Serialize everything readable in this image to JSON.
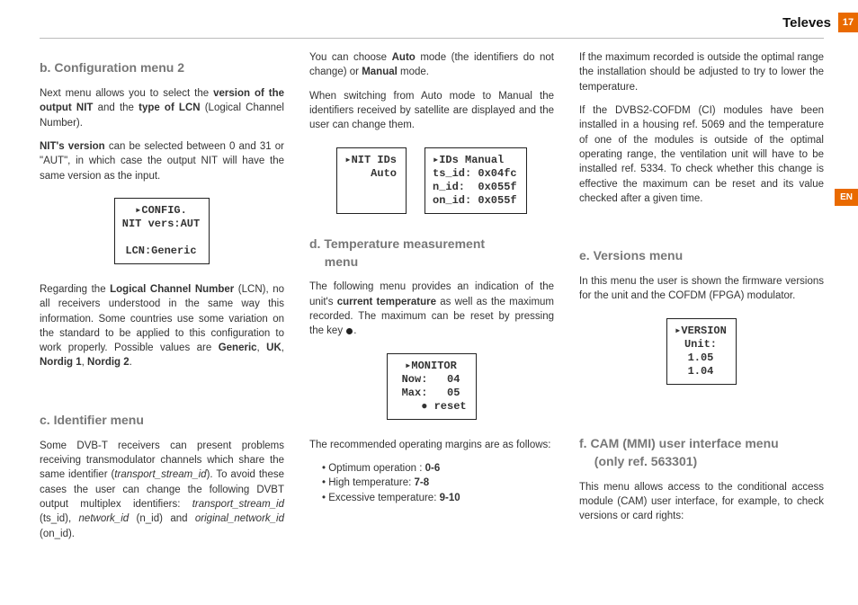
{
  "header": {
    "brand": "Televes",
    "pagenum": "17",
    "lang": "EN"
  },
  "col1": {
    "h_b": "b. Configuration menu 2",
    "p1a": "Next menu allows you to select the ",
    "p1b": "version of the output NIT",
    "p1c": " and the ",
    "p1d": "type of LCN",
    "p1e": " (Logical Channel Number).",
    "p2a": "NIT's version",
    "p2b": " can be selected between 0 and 31 or \"AUT\", in which case the output NIT will have the same version as the input.",
    "lcd1": "▸CONFIG.\nNIT vers:AUT\n\nLCN:Generic",
    "p3a": "Regarding the ",
    "p3b": "Logical Channel Number",
    "p3c": " (LCN), no all receivers understood in the same way this information. Some countries use some variation on the standard to be applied to this configuration to work properly. Possible values are ",
    "p3d": "Generic",
    "p3e": ", ",
    "p3f": "UK",
    "p3g": ", ",
    "p3h": "Nordig 1",
    "p3i": ", ",
    "p3j": "Nordig 2",
    "p3k": ".",
    "h_c": "c. Identifier menu",
    "p4a": "Some DVB-T receivers can present problems receiving transmodulator channels which share the same identifier (",
    "p4b": "transport_stream_id",
    "p4c": "). To avoid these cases the user can change the following DVBT output multiplex identifiers: ",
    "p4d": "transport_stream_id",
    "p4e": " (ts_id), ",
    "p4f": "network_id",
    "p4g": " (n_id) and ",
    "p4h": "original_network_id",
    "p4i": " (on_id)."
  },
  "col2": {
    "p1a": "You can choose ",
    "p1b": "Auto",
    "p1c": " mode (the identifiers do not change) or ",
    "p1d": "Manual",
    "p1e": " mode.",
    "p2": "When switching from Auto mode to Manual the identifiers received by satellite are displayed and the user can change them.",
    "lcdA": "▸NIT IDs\n    Auto",
    "lcdB": "▸IDs Manual\nts_id: 0x04fc\nn_id:  0x055f\non_id: 0x055f",
    "h_d_line1": "d. Temperature measurement",
    "h_d_line2": "menu",
    "p3a": "The following menu provides an indication of the unit's ",
    "p3b": "current temperature",
    "p3c": " as well as the maximum recorded. The maximum can be reset by pressing the key ",
    "p3d": ".",
    "lcdC": "▸MONITOR\nNow:   04\nMax:   05\n    ● reset",
    "p4": "The recommended operating margins are as follows:",
    "li1a": "Optimum operation : ",
    "li1b": "0-6",
    "li2a": "High temperature: ",
    "li2b": "7-8",
    "li3a": "Excessive temperature: ",
    "li3b": "9-10"
  },
  "col3": {
    "p1": "If the maximum recorded is outside the optimal range the installation should be adjusted to try to lower the temperature.",
    "p2": "If the DVBS2-COFDM (CI) modules have been installed in a housing ref. 5069 and the temperature of one of the modules is outside of the optimal operating range, the ventilation unit will have to be installed ref. 5334. To check whether this change is effective the maximum can be reset and its value checked after a given time.",
    "h_e": "e. Versions menu",
    "p3": "In this menu the user is shown the firmware versions for the unit and the COFDM (FPGA) modulator.",
    "lcdD": "▸VERSION\nUnit:\n1.05\n1.04",
    "h_f_line1": "f. CAM (MMI) user interface menu",
    "h_f_line2": "(only ref. 563301)",
    "p4": "This menu allows access to the conditional access module (CAM) user interface, for example, to check versions or card rights:"
  }
}
